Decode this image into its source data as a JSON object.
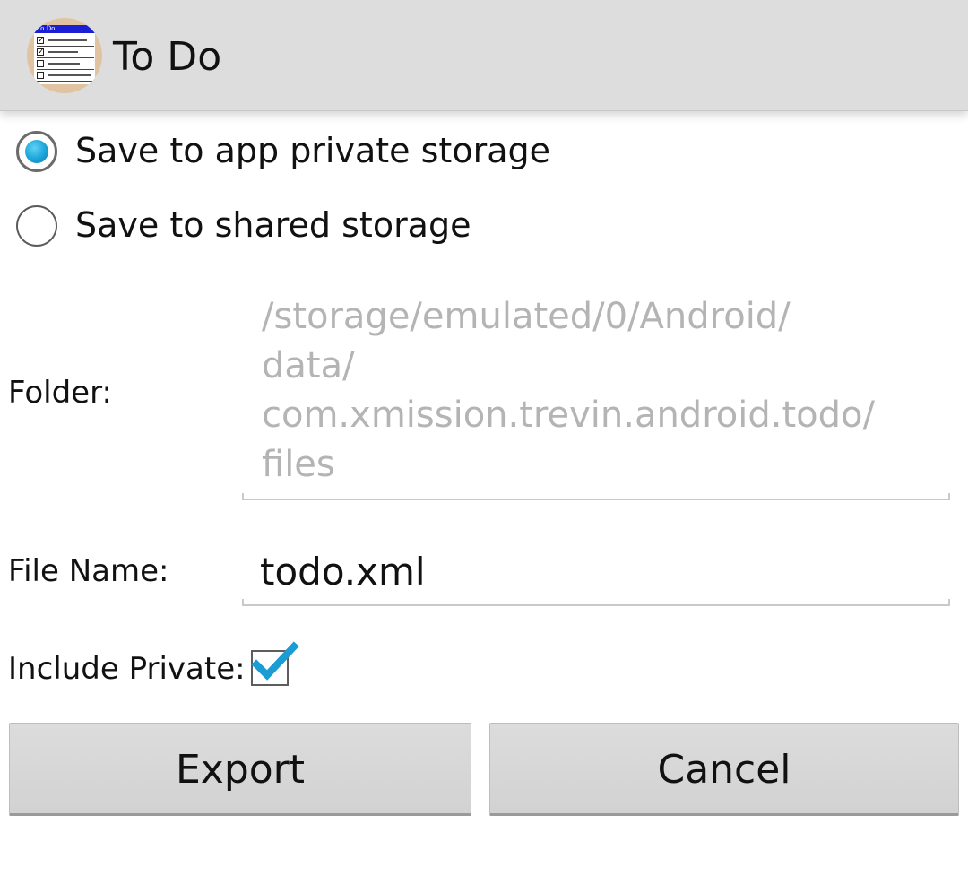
{
  "app_bar": {
    "title": "To Do",
    "icon": "todo-list-app-icon",
    "icon_paper": {
      "header": "To Do",
      "items": [
        {
          "text": "Steal Fry's more",
          "checked": true
        },
        {
          "text": "Buy more beer",
          "checked": true
        },
        {
          "text": "Kill all humans",
          "checked": false
        },
        {
          "text": "Bite my shiny me",
          "checked": false
        }
      ]
    }
  },
  "storage_options": [
    {
      "label": "Save to app private storage",
      "selected": true
    },
    {
      "label": "Save to shared storage",
      "selected": false
    }
  ],
  "folder": {
    "label": "Folder:",
    "value": "/storage/emulated/0/Android/data/com.xmission.trevin.android.todo/files",
    "lines": [
      "/storage/emulated/0/Android/",
      "data/",
      "com.xmission.trevin.android.todo/",
      "files"
    ]
  },
  "file_name": {
    "label": "File Name:",
    "value": "todo.xml"
  },
  "include_private": {
    "label": "Include Private:",
    "checked": true
  },
  "buttons": {
    "export_label": "Export",
    "cancel_label": "Cancel"
  },
  "colors": {
    "accent": "#19a4d8",
    "app_bar_bg": "#dddddd",
    "disabled_text": "#b4b4b4",
    "button_bg": "#d6d6d6"
  }
}
